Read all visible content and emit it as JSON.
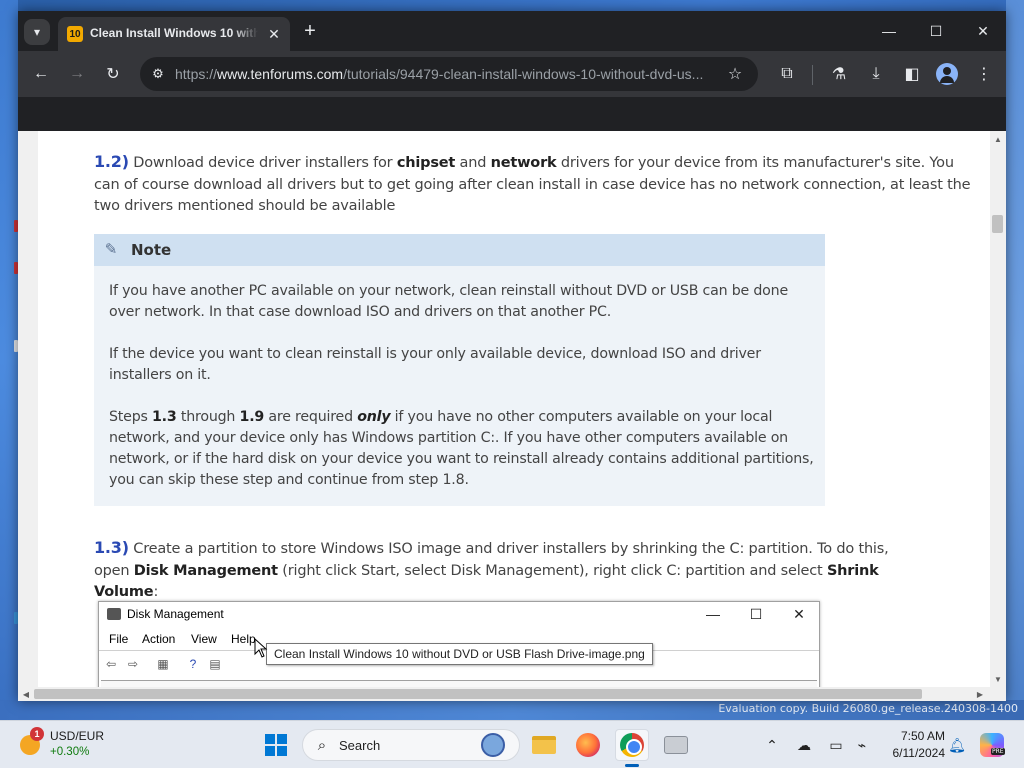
{
  "browser": {
    "tab_title": "Clean Install Windows 10 without DVD or USB Flash Drive",
    "tab_favicon": "10",
    "url_scheme": "https://",
    "url_host": "www.tenforums.com",
    "url_path": "/tutorials/94479-clean-install-windows-10-without-dvd-us...",
    "icons": [
      "tab-search-icon",
      "close-icon",
      "plus-icon",
      "minimize-icon",
      "maximize-icon",
      "close-window-icon",
      "back-icon",
      "forward-icon",
      "reload-icon",
      "site-settings-icon",
      "star-icon",
      "extensions-icon",
      "labs-icon",
      "download-icon",
      "sidebar-icon",
      "profile-icon",
      "menu-icon"
    ]
  },
  "article": {
    "step12_num": "1.2)",
    "step12_a": " Download device driver installers for ",
    "step12_b1": "chipset",
    "step12_b": " and ",
    "step12_b2": "network",
    "step12_c": " drivers for your device from its manufacturer's site. You can of course download all drivers but to get going after clean install in case device has no network connection, at least the two drivers mentioned should be available",
    "note": {
      "title": "Note",
      "p1": "If you have another PC available on your network, clean reinstall without DVD or USB can be done over network. In that case download ISO and drivers on that another PC.",
      "p2": "If the device you want to clean reinstall is your only available device, download ISO and driver installers on it.",
      "p3_a": "Steps ",
      "p3_b1": "1.3",
      "p3_b": " through ",
      "p3_b2": "1.9",
      "p3_c": " are required ",
      "p3_only": "only",
      "p3_d": " if you have no other computers available on your local network, and your device only has Windows partition C:. If you have other computers available on network, or if the hard disk on your device you want to reinstall already contains additional partitions, you can skip these step and continue from step 1.8."
    },
    "step13_num": "1.3)",
    "step13_a": " Create a partition to store Windows ISO image and driver installers by shrinking the C: partition. To do this, open ",
    "step13_b1": "Disk Management",
    "step13_b": " (right click Start, select Disk Management), right click C: partition and select ",
    "step13_b2": "Shrink Volume",
    "step13_c": ":"
  },
  "disk_management": {
    "title": "Disk Management",
    "menu": [
      "File",
      "Action",
      "View",
      "Help"
    ],
    "tooltip": "Clean Install Windows 10 without DVD or USB Flash Drive-image.png"
  },
  "desktop": {
    "watermark": "Evaluation copy. Build 26080.ge_release.240308-1400"
  },
  "taskbar": {
    "fx_pair": "USD/EUR",
    "fx_change": "+0.30%",
    "weather_badge": "1",
    "search_placeholder": "Search",
    "time": "7:50 AM",
    "date": "6/11/2024",
    "copilot_tag": "PRE"
  }
}
